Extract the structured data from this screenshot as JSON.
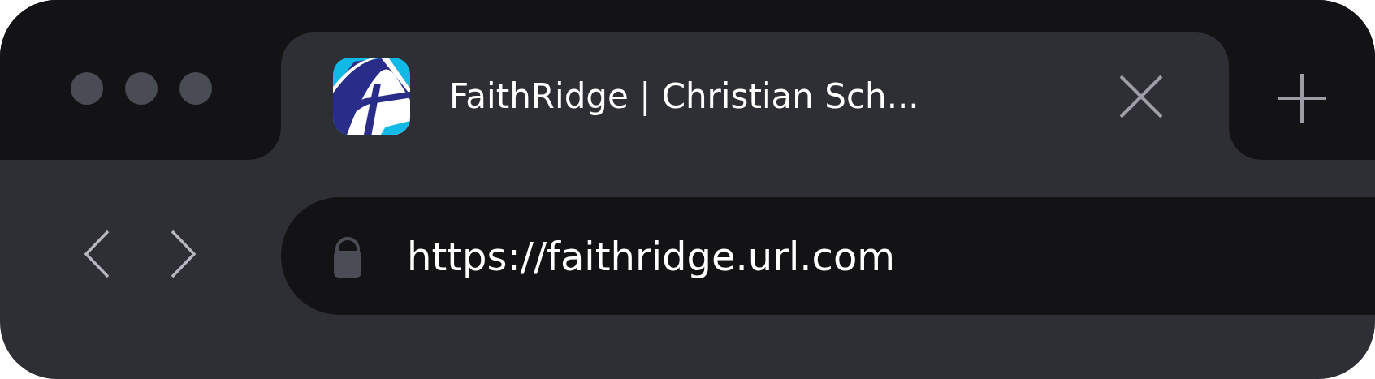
{
  "tabs": [
    {
      "title": "FaithRidge | Christian Sch...",
      "selected": true
    }
  ],
  "address_bar": {
    "url": "https://faithridge.url.com"
  }
}
